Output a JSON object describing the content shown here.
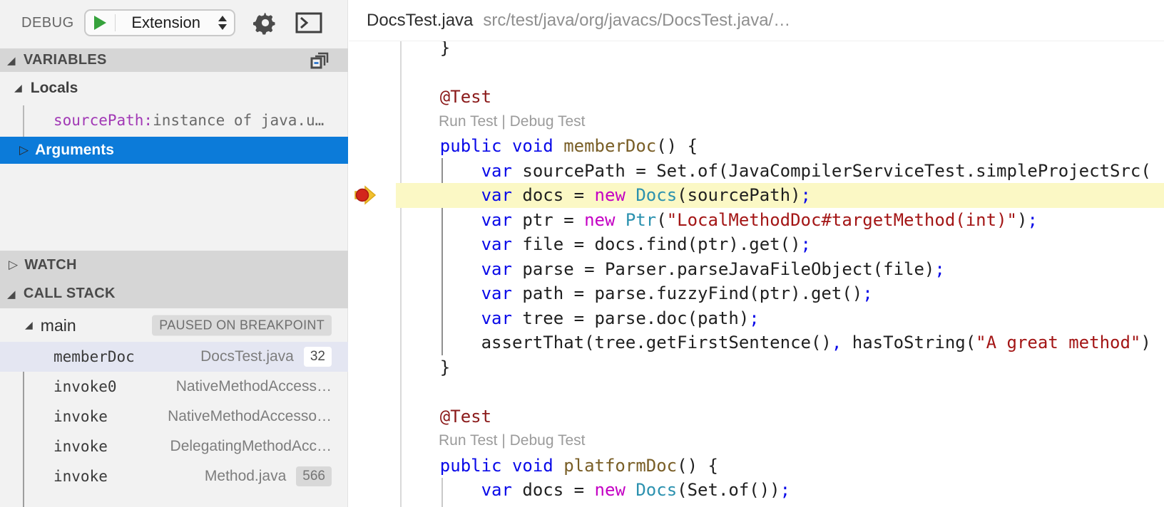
{
  "sidebar": {
    "toolbar": {
      "title": "DEBUG",
      "launch_config": "Extension",
      "icons": [
        "start-debug",
        "dropdown-arrows",
        "settings-gear",
        "debug-console"
      ]
    },
    "variables": {
      "header": "VARIABLES",
      "header_icon": "collapse-all",
      "locals_label": "Locals",
      "variable": {
        "name": "sourcePath:",
        "value": "instance of java.u…"
      },
      "arguments_label": "Arguments"
    },
    "watch": {
      "header": "WATCH"
    },
    "call_stack": {
      "header": "CALL STACK",
      "thread": "main",
      "status": "PAUSED ON BREAKPOINT",
      "frames": [
        {
          "name": "memberDoc",
          "file": "DocsTest.java",
          "line": "32",
          "badge": "white",
          "selected": true
        },
        {
          "name": "invoke0",
          "file": "NativeMethodAccess…"
        },
        {
          "name": "invoke",
          "file": "NativeMethodAccesso…"
        },
        {
          "name": "invoke",
          "file": "DelegatingMethodAcc…"
        },
        {
          "name": "invoke",
          "file": "Method.java",
          "line": "566",
          "badge": "gray"
        }
      ]
    }
  },
  "editor": {
    "title": "DocsTest.java",
    "path": "src/test/java/org/javacs/DocsTest.java/…",
    "breakpoint_on_current_line": true,
    "lines": [
      {
        "tokens": [
          [
            "plain",
            "    }"
          ]
        ]
      },
      {
        "tokens": []
      },
      {
        "tokens": [
          [
            "ann",
            "    @Test"
          ]
        ]
      },
      {
        "lens": "Run Test | Debug Test"
      },
      {
        "tokens": [
          [
            "kw",
            "    public void "
          ],
          [
            "fn",
            "memberDoc"
          ],
          [
            "plain",
            "() {"
          ]
        ]
      },
      {
        "tokens": [
          [
            "kw",
            "        var "
          ],
          [
            "plain",
            "sourcePath = Set.of(JavaCompilerServiceTest.simpleProjectSrc("
          ]
        ]
      },
      {
        "current": true,
        "tokens": [
          [
            "kw",
            "        var "
          ],
          [
            "plain",
            "docs = "
          ],
          [
            "ctl",
            "new "
          ],
          [
            "type",
            "Docs"
          ],
          [
            "plain",
            "(sourcePath)"
          ],
          [
            "kw",
            ";"
          ]
        ]
      },
      {
        "tokens": [
          [
            "kw",
            "        var "
          ],
          [
            "plain",
            "ptr = "
          ],
          [
            "ctl",
            "new "
          ],
          [
            "type",
            "Ptr"
          ],
          [
            "plain",
            "("
          ],
          [
            "str",
            "\"LocalMethodDoc#targetMethod(int)\""
          ],
          [
            "plain",
            ")"
          ],
          [
            "kw",
            ";"
          ]
        ]
      },
      {
        "tokens": [
          [
            "kw",
            "        var "
          ],
          [
            "plain",
            "file = docs.find(ptr).get()"
          ],
          [
            "kw",
            ";"
          ]
        ]
      },
      {
        "tokens": [
          [
            "kw",
            "        var "
          ],
          [
            "plain",
            "parse = Parser.parseJavaFileObject(file)"
          ],
          [
            "kw",
            ";"
          ]
        ]
      },
      {
        "tokens": [
          [
            "kw",
            "        var "
          ],
          [
            "plain",
            "path = parse.fuzzyFind(ptr).get()"
          ],
          [
            "kw",
            ";"
          ]
        ]
      },
      {
        "tokens": [
          [
            "kw",
            "        var "
          ],
          [
            "plain",
            "tree = parse.doc(path)"
          ],
          [
            "kw",
            ";"
          ]
        ]
      },
      {
        "tokens": [
          [
            "plain",
            "        assertThat(tree.getFirstSentence()"
          ],
          [
            "kw",
            ","
          ],
          [
            "plain",
            " hasToString("
          ],
          [
            "str",
            "\"A great method\""
          ],
          [
            "plain",
            ")"
          ]
        ]
      },
      {
        "tokens": [
          [
            "plain",
            "    }"
          ]
        ]
      },
      {
        "tokens": []
      },
      {
        "tokens": [
          [
            "ann",
            "    @Test"
          ]
        ]
      },
      {
        "lens": "Run Test | Debug Test"
      },
      {
        "tokens": [
          [
            "kw",
            "    public void "
          ],
          [
            "fn",
            "platformDoc"
          ],
          [
            "plain",
            "() {"
          ]
        ]
      },
      {
        "tokens": [
          [
            "kw",
            "        var "
          ],
          [
            "plain",
            "docs = "
          ],
          [
            "ctl",
            "new "
          ],
          [
            "type",
            "Docs"
          ],
          [
            "plain",
            "(Set.of())"
          ],
          [
            "kw",
            ";"
          ]
        ]
      }
    ]
  },
  "colors": {
    "selection_blue": "#0C7BD9",
    "current_line_yellow": "#FBF8C5",
    "breakpoint_red": "#D3261C",
    "execution_pointer_yellow": "#F2C12E",
    "keyword_blue": "#0909E8",
    "new_keyword_magenta": "#C400C4",
    "type_teal": "#2B91AF",
    "function_olive": "#795E26",
    "string_red": "#A31515",
    "annotation_maroon": "#8B1A1A",
    "section_header_gray": "#D6D6D6",
    "frame_selection_lavender": "#E4E6F2"
  }
}
